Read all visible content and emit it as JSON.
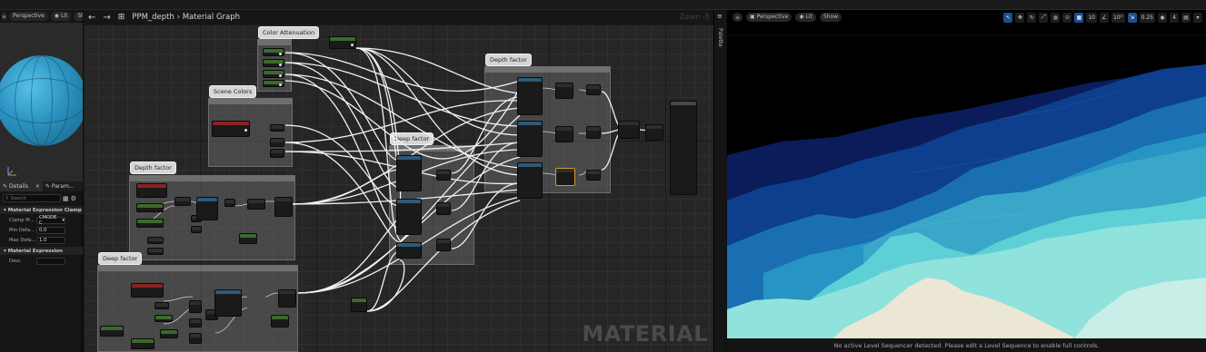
{
  "left_panel": {
    "toolbar": {
      "menu_icon": "hamburger-icon",
      "perspective": "Perspective",
      "lit": "Lit",
      "show": "Show"
    },
    "details_tab": "Details",
    "details_close": "×",
    "params_tab": "Param...",
    "search_placeholder": "Search",
    "section_clamp": "Material Expression Clamp",
    "clamp_mode_label": "Clamp M...",
    "clamp_mode_value": "CMODE C",
    "min_label": "Min Defa...",
    "min_value": "0.0",
    "max_label": "Max Defa...",
    "max_value": "1.0",
    "section_expression": "Material Expression",
    "desc_label": "Desc"
  },
  "graph": {
    "breadcrumb_root": "PPM_depth",
    "separator": "›",
    "breadcrumb_leaf": "Material Graph",
    "zoom": "Zoom -5",
    "watermark": "MATERIAL",
    "palette": "Palette",
    "comments": {
      "color_attenuation": "Color Attenuation",
      "scene_colors": "Scene Colors",
      "depth_factor_left": "Depth factor",
      "deep_factor_bottom": "Deep factor",
      "deep_factor_mid": "Deep factor",
      "depth_factor_right": "Depth factor"
    }
  },
  "viewport": {
    "perspective": "Perspective",
    "lit": "Lit",
    "show": "Show",
    "grid_snap": "10",
    "rot_snap": "10°",
    "scale_snap": "0.25",
    "cam_speed": "4",
    "status": "No active Level Sequencer detected. Please edit a Level Sequence to enable full controls."
  },
  "colors": {
    "accent": "#1e4d8e",
    "node_green": "#3b6a2c",
    "node_red": "#8a2222",
    "wire": "#ffffff"
  }
}
